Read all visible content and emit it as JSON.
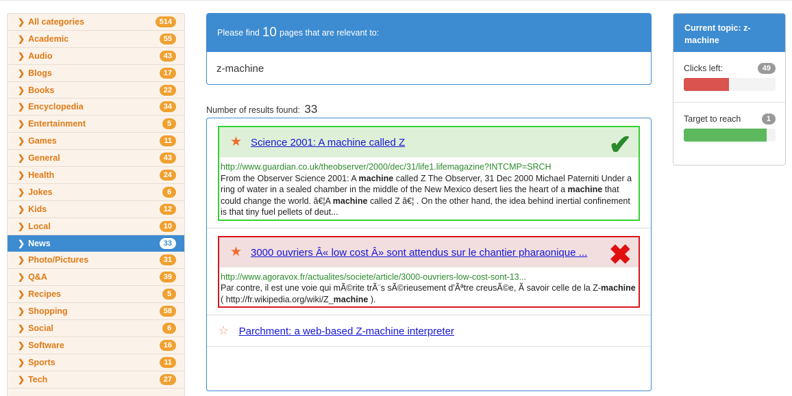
{
  "sidebar": {
    "items": [
      {
        "label": "All categories",
        "count": "514"
      },
      {
        "label": "Academic",
        "count": "55"
      },
      {
        "label": "Audio",
        "count": "43"
      },
      {
        "label": "Blogs",
        "count": "17"
      },
      {
        "label": "Books",
        "count": "22"
      },
      {
        "label": "Encyclopedia",
        "count": "34"
      },
      {
        "label": "Entertainment",
        "count": "5"
      },
      {
        "label": "Games",
        "count": "11"
      },
      {
        "label": "General",
        "count": "43"
      },
      {
        "label": "Health",
        "count": "24"
      },
      {
        "label": "Jokes",
        "count": "6"
      },
      {
        "label": "Kids",
        "count": "12"
      },
      {
        "label": "Local",
        "count": "10"
      },
      {
        "label": "News",
        "count": "33",
        "active": true
      },
      {
        "label": "Photo/Pictures",
        "count": "31"
      },
      {
        "label": "Q&A",
        "count": "39"
      },
      {
        "label": "Recipes",
        "count": "5"
      },
      {
        "label": "Shopping",
        "count": "58"
      },
      {
        "label": "Social",
        "count": "6"
      },
      {
        "label": "Software",
        "count": "16"
      },
      {
        "label": "Sports",
        "count": "11"
      },
      {
        "label": "Tech",
        "count": "27"
      }
    ]
  },
  "query": {
    "prefix": "Please find",
    "number": "10",
    "suffix": "pages that are relevant to:",
    "text": "z-machine"
  },
  "results_count": {
    "label": "Number of results found:",
    "value": "33"
  },
  "results": [
    {
      "title": "Science 2001: A machine called Z",
      "url": "http://www.guardian.co.uk/theobserver/2000/dec/31/life1.lifemagazine?INTCMP=SRCH",
      "snippet_parts": [
        "From the Observer Science 2001: A ",
        "machine",
        " called Z The Observer, 31 Dec 2000 Michael Paterniti Under a ring of water in a sealed chamber in the middle of the New Mexico desert lies the heart of a ",
        "machine",
        " that could change the world. â€¦A ",
        "machine",
        " called Z â€¦ . On the other hand, the idea behind inertial confinement is that tiny fuel pellets of deut..."
      ],
      "status": "relevant",
      "mark": "✔"
    },
    {
      "title": "3000 ouvriers Â« low cost Â» sont attendus sur le chantier pharaonique ...",
      "url": "http://www.agoravox.fr/actualites/societe/article/3000-ouvriers-low-cost-sont-13...",
      "snippet_parts": [
        "Par contre, il est une voie qui mÃ©rite trÃ¨s sÃ©rieusement d'Ãªtre creusÃ©e, Ã  savoir celle de la Z-",
        "machine",
        " ( http://fr.wikipedia.org/wiki/Z_",
        "machine",
        " )."
      ],
      "status": "not-relevant",
      "mark": "✖"
    },
    {
      "title": "Parchment: a web-based Z-machine interpreter"
    }
  ],
  "topic": {
    "title": "Current topic: z-machine",
    "clicks_label": "Clicks left:",
    "clicks_value": "49",
    "clicks_fraction": 0.49,
    "target_label": "Target to reach",
    "target_value": "1",
    "target_fraction": 0.9
  },
  "colors": {
    "accent": "#3d8bd0",
    "category_text": "#e07a16",
    "badge": "#f0a030",
    "relevant": "#32d232",
    "not_relevant": "#d9141b"
  },
  "icons": {
    "category": "chevron-right-icon",
    "favorite": "star-icon",
    "relevant": "checkmark-icon",
    "not_relevant": "cross-icon"
  }
}
